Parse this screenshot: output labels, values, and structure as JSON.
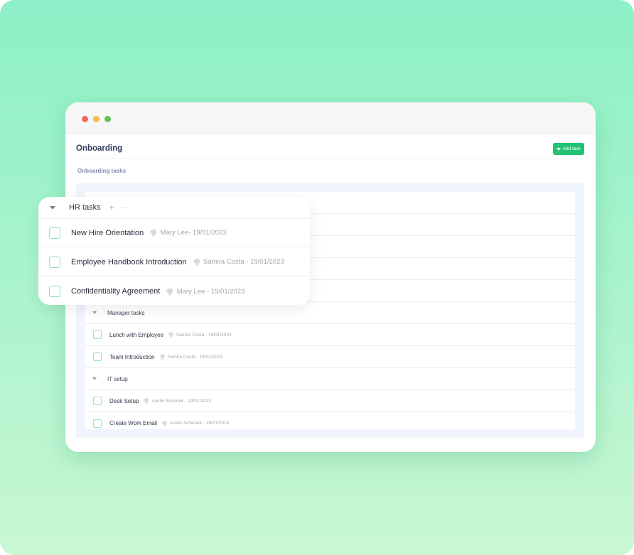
{
  "window": {
    "title": "Onboarding",
    "add_task_label": "Add task",
    "section_label": "Onboarding tasks",
    "accent_color": "#22c274"
  },
  "floating_card": {
    "group_name": "HR tasks",
    "add_icon": "+",
    "more_icon": "···",
    "tasks": [
      {
        "name": "New Hire Orientation",
        "meta": "Mary Lee- 19/01/2023"
      },
      {
        "name": "Employee Handbook Introduction",
        "meta": "Samira Costa - 19/01/2023"
      },
      {
        "name": "Confidentiality Agreement",
        "meta": "Mary Lee - 19/01/2023"
      }
    ]
  },
  "list": {
    "groups": [
      {
        "name": "Manager tasks",
        "tasks": [
          {
            "name": "Lunch with Employee",
            "meta": "Samira Costa - 19/01/2023"
          },
          {
            "name": "Team Introduction",
            "meta": "Samira Costa - 19/01/2023"
          }
        ]
      },
      {
        "name": "IT setup",
        "tasks": [
          {
            "name": "Desk Setup",
            "meta": "Austin Schenek - 19/01/2023"
          },
          {
            "name": "Create Work Email",
            "meta": "Austin Schenek - 19/01/2023"
          }
        ]
      }
    ]
  },
  "icons": {
    "attachment": "📎"
  }
}
